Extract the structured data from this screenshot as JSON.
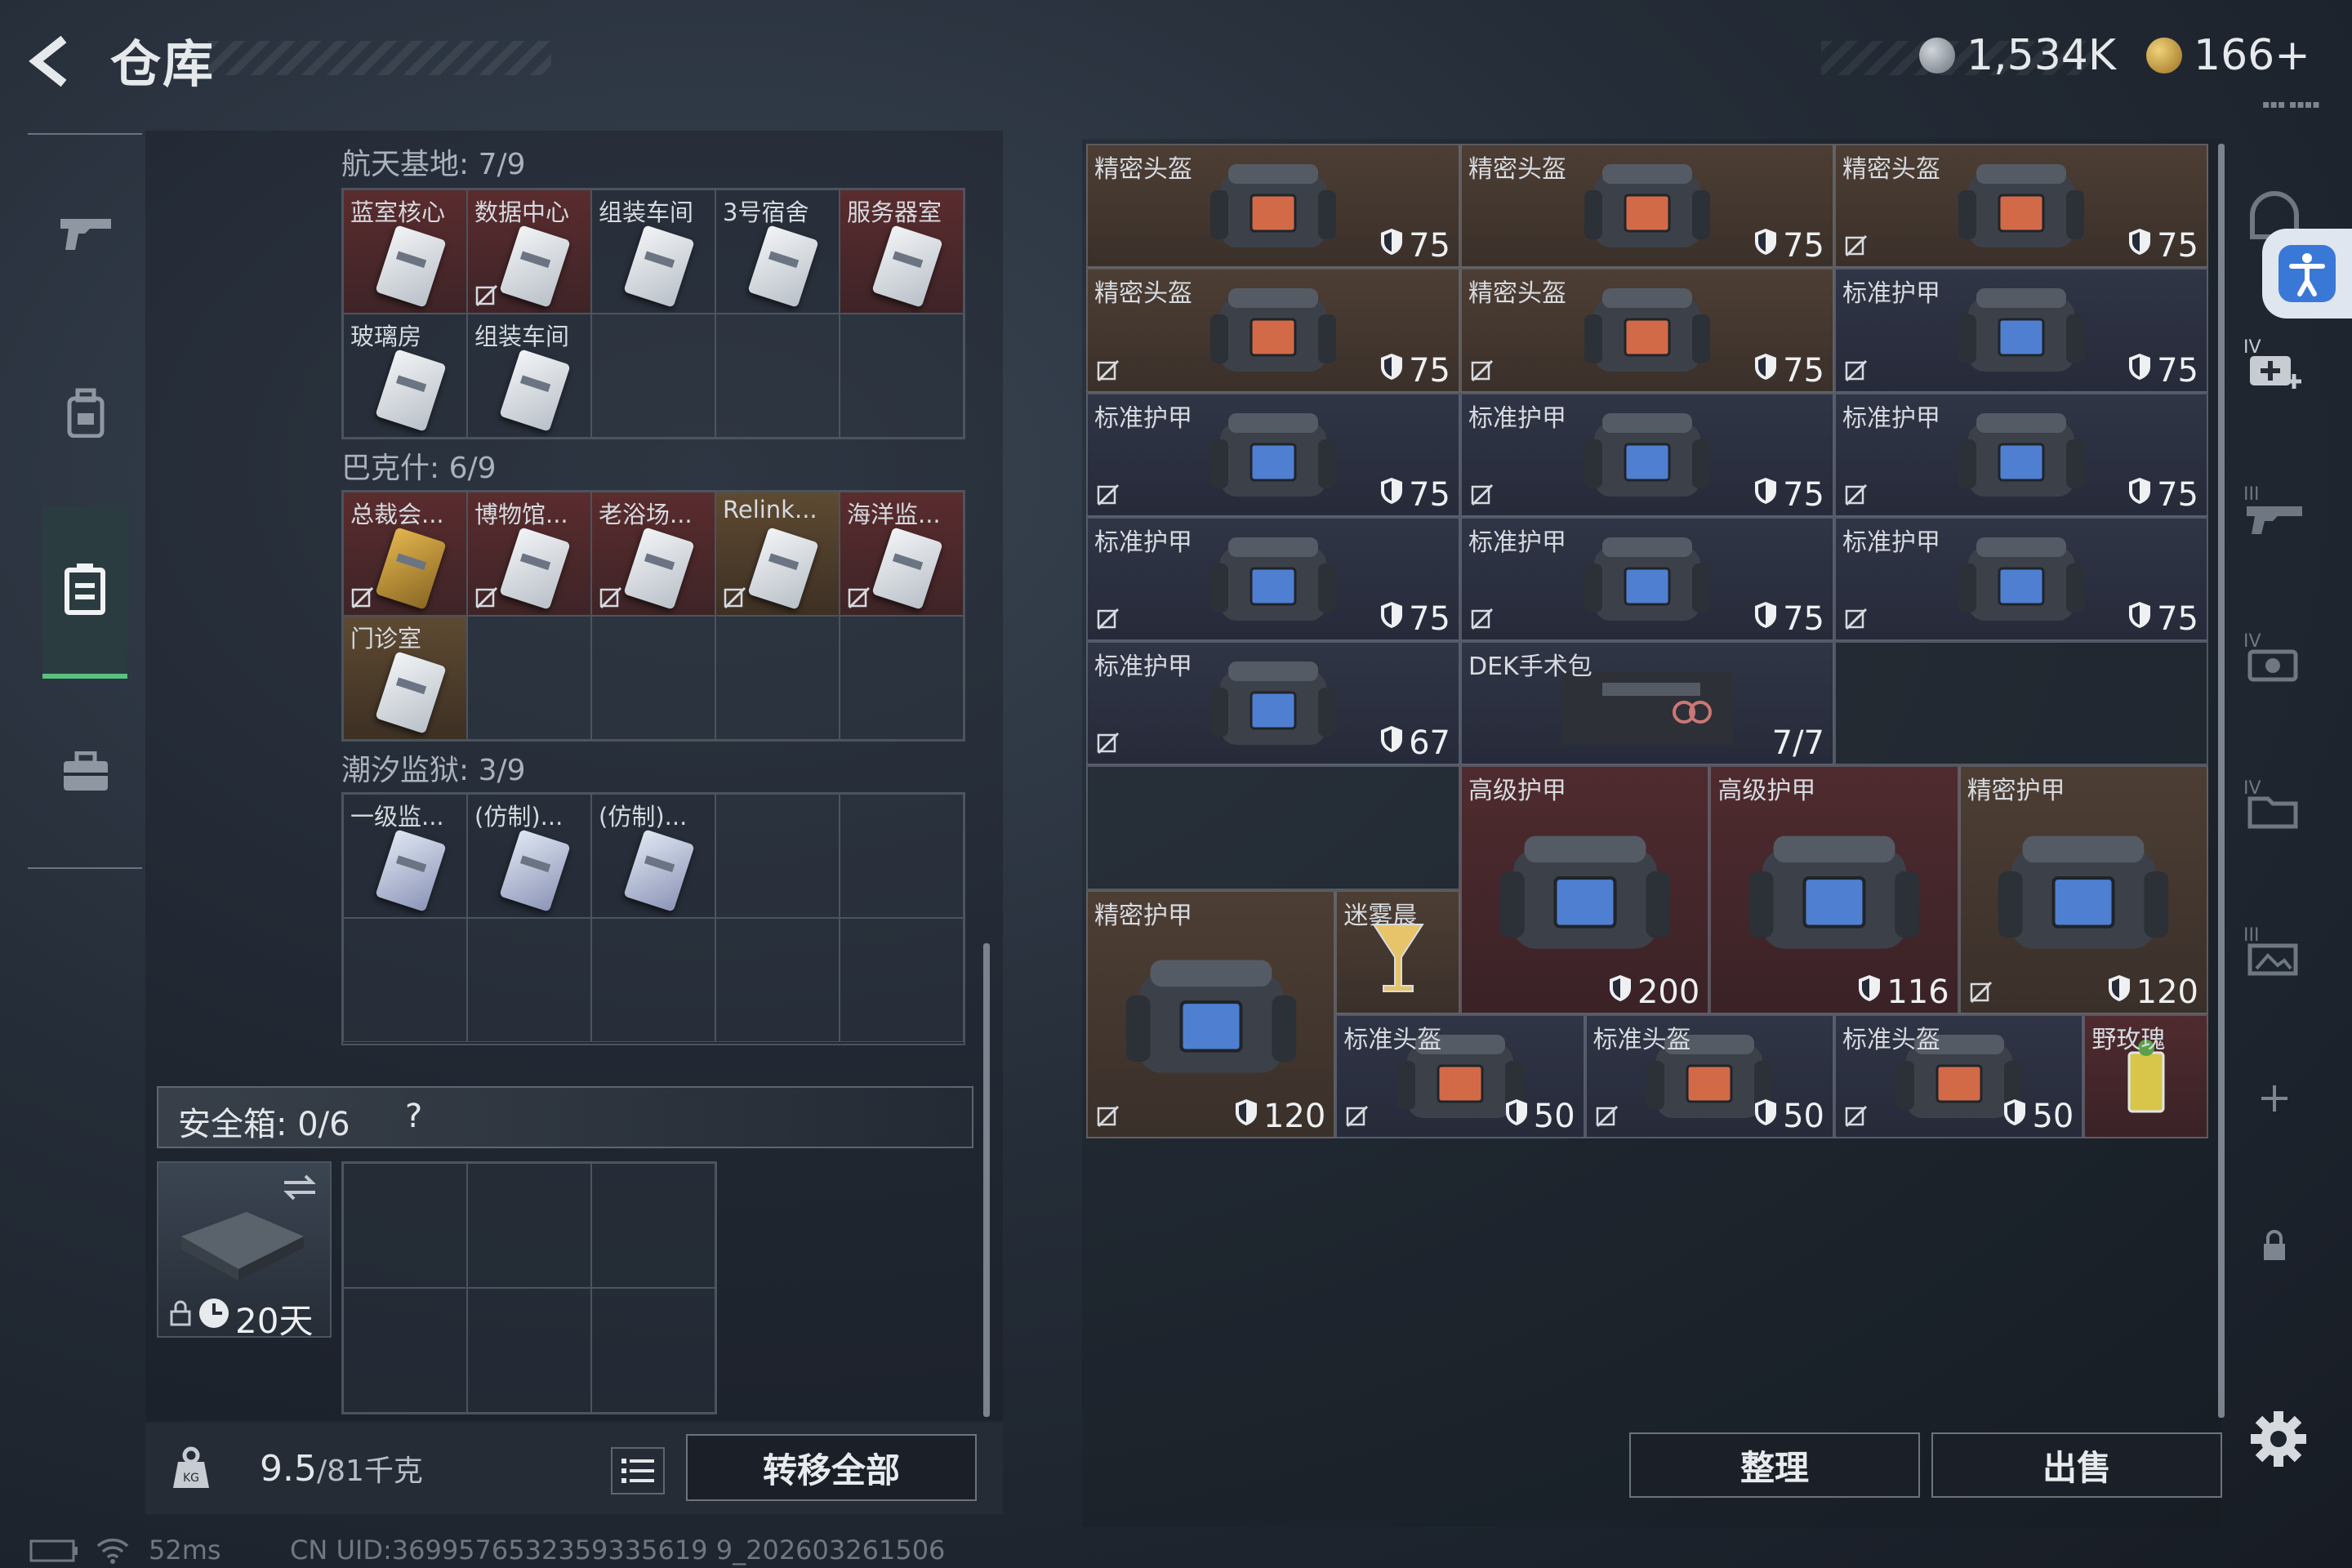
{
  "header": {
    "title": "仓库",
    "currency1": "1,534K",
    "currency2": "166+",
    "dim_text": "▪▪▪ ▪▪▪▪"
  },
  "sections": [
    {
      "title": "航天基地: 7/9",
      "slots": [
        {
          "label": "蓝室核心",
          "color": "red",
          "card": "white",
          "nodrop": false
        },
        {
          "label": "数据中心",
          "color": "red",
          "card": "white",
          "nodrop": true
        },
        {
          "label": "组装车间",
          "color": "dark",
          "card": "white",
          "nodrop": false
        },
        {
          "label": "3号宿舍",
          "color": "dark",
          "card": "white",
          "nodrop": false
        },
        {
          "label": "服务器室",
          "color": "red",
          "card": "white",
          "nodrop": false
        },
        {
          "label": "玻璃房",
          "color": "dark",
          "card": "white",
          "nodrop": false
        },
        {
          "label": "组装车间",
          "color": "dark",
          "card": "white",
          "nodrop": false
        }
      ]
    },
    {
      "title": "巴克什: 6/9",
      "slots": [
        {
          "label": "总裁会...",
          "color": "red",
          "card": "gold",
          "nodrop": true
        },
        {
          "label": "博物馆...",
          "color": "red",
          "card": "white",
          "nodrop": true
        },
        {
          "label": "老浴场...",
          "color": "red",
          "card": "white",
          "nodrop": true
        },
        {
          "label": "Relink...",
          "color": "gold",
          "card": "white",
          "nodrop": true
        },
        {
          "label": "海洋监...",
          "color": "red",
          "card": "white",
          "nodrop": true
        },
        {
          "label": "门诊室",
          "color": "gold",
          "card": "white",
          "nodrop": false
        }
      ]
    },
    {
      "title": "潮汐监狱: 3/9",
      "slots": [
        {
          "label": "一级监...",
          "color": "dark",
          "card": "bluef",
          "nodrop": false
        },
        {
          "label": "(仿制)...",
          "color": "dark",
          "card": "bluef",
          "nodrop": false
        },
        {
          "label": "(仿制)...",
          "color": "dark",
          "card": "bluef",
          "nodrop": false
        }
      ]
    }
  ],
  "safe_box": {
    "label": "安全箱: 0/6",
    "help": "?",
    "timer": "20天"
  },
  "bottom_left": {
    "weight": "9.5",
    "weight_max": "/81千克",
    "transfer_all": "转移全部"
  },
  "inventory": [
    {
      "label": "精密头盔",
      "value": "75",
      "type": "helmet",
      "color": "brown",
      "nodrop": false
    },
    {
      "label": "精密头盔",
      "value": "75",
      "type": "helmet",
      "color": "brown",
      "nodrop": false
    },
    {
      "label": "精密头盔",
      "value": "75",
      "type": "helmet",
      "color": "brown",
      "nodrop": true
    },
    {
      "label": "精密头盔",
      "value": "75",
      "type": "helmet",
      "color": "brown",
      "nodrop": true
    },
    {
      "label": "精密头盔",
      "value": "75",
      "type": "helmet",
      "color": "brown",
      "nodrop": true
    },
    {
      "label": "标准护甲",
      "value": "75",
      "type": "armor",
      "color": "navy",
      "nodrop": true
    },
    {
      "label": "标准护甲",
      "value": "75",
      "type": "armor",
      "color": "navy",
      "nodrop": true
    },
    {
      "label": "标准护甲",
      "value": "75",
      "type": "armor",
      "color": "navy",
      "nodrop": true
    },
    {
      "label": "标准护甲",
      "value": "75",
      "type": "armor",
      "color": "navy",
      "nodrop": true
    },
    {
      "label": "标准护甲",
      "value": "75",
      "type": "armor",
      "color": "navy",
      "nodrop": true
    },
    {
      "label": "标准护甲",
      "value": "75",
      "type": "armor",
      "color": "navy",
      "nodrop": true
    },
    {
      "label": "标准护甲",
      "value": "75",
      "type": "armor",
      "color": "navy",
      "nodrop": true
    },
    {
      "label": "标准护甲",
      "value": "67",
      "type": "armor",
      "color": "navy",
      "nodrop": true
    },
    {
      "label": "DEK手术包",
      "value": "7/7",
      "type": "kit",
      "color": "navy",
      "nodrop": false
    },
    {
      "label": "高级护甲",
      "value": "200",
      "type": "bigarmor",
      "color": "red",
      "nodrop": false
    },
    {
      "label": "高级护甲",
      "value": "116",
      "type": "bigarmor",
      "color": "red",
      "nodrop": false
    },
    {
      "label": "精密护甲",
      "value": "120",
      "type": "bigarmor",
      "color": "brown",
      "nodrop": true
    },
    {
      "label": "精密护甲",
      "value": "120",
      "type": "bigarmor",
      "color": "brown",
      "nodrop": true
    },
    {
      "label": "迷雾晨",
      "value": "",
      "type": "drink",
      "color": "brown",
      "nodrop": false
    },
    {
      "label": "标准头盔",
      "value": "50",
      "type": "helmet",
      "color": "navy",
      "nodrop": true
    },
    {
      "label": "标准头盔",
      "value": "50",
      "type": "helmet",
      "color": "navy",
      "nodrop": true
    },
    {
      "label": "标准头盔",
      "value": "50",
      "type": "helmet",
      "color": "navy",
      "nodrop": true
    },
    {
      "label": "野玫瑰",
      "value": "",
      "type": "drink2",
      "color": "red",
      "nodrop": false
    }
  ],
  "bottom_right": {
    "sort": "整理",
    "sell": "出售"
  },
  "status_bar": {
    "ping": "52ms",
    "uid": "CN UID:3699576532359335619 9_202603261506"
  }
}
